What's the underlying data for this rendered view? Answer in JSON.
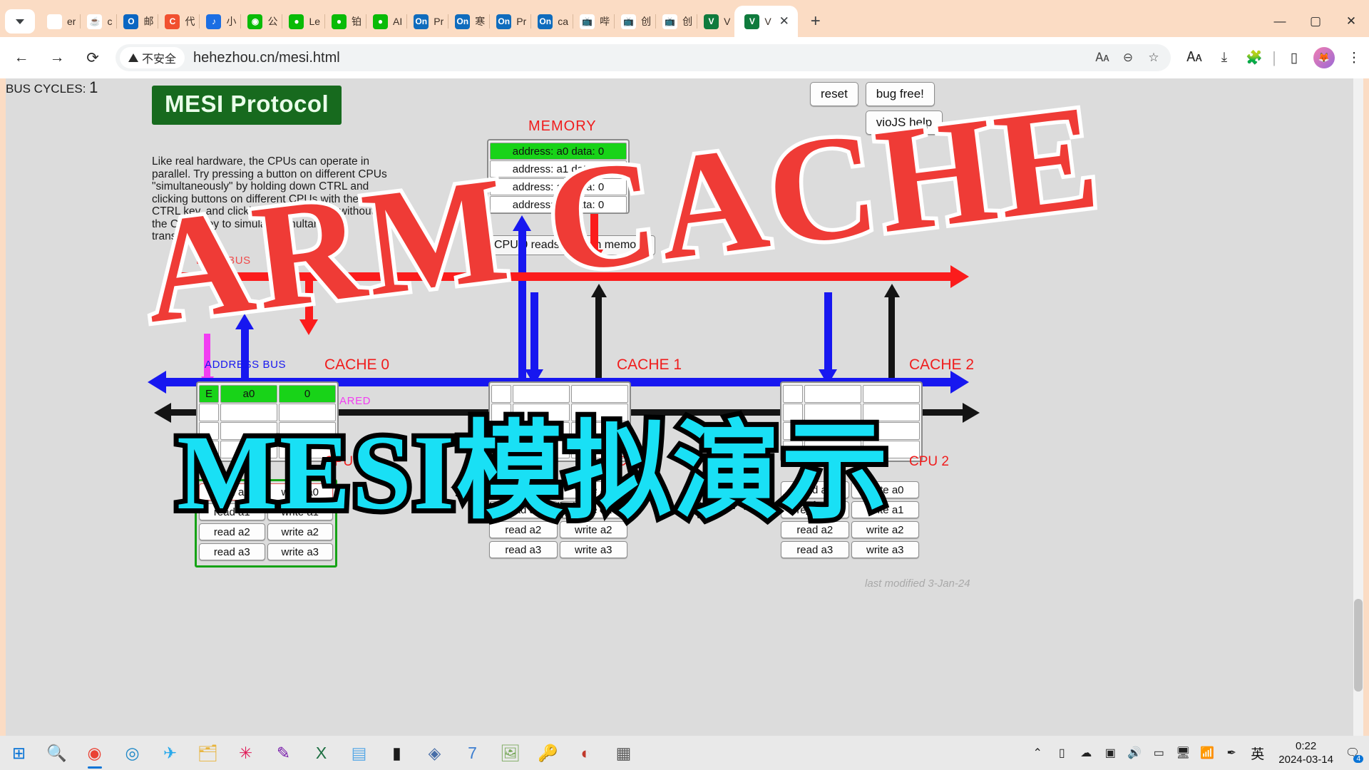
{
  "browser": {
    "tabs": [
      {
        "title": "er",
        "icon": "google-icon",
        "icon_glyph": "G",
        "style": "fav-g"
      },
      {
        "title": "c",
        "icon": "java-icon",
        "icon_glyph": "☕",
        "style": "fav-java"
      },
      {
        "title": "邮",
        "icon": "outlook-icon",
        "icon_glyph": "O",
        "style": "fav-out"
      },
      {
        "title": "代",
        "icon": "c-icon",
        "icon_glyph": "C",
        "style": "fav-c"
      },
      {
        "title": "小",
        "icon": "blue-circle-icon",
        "icon_glyph": "♪",
        "style": "fav-blue"
      },
      {
        "title": "公",
        "icon": "green-swirl-icon",
        "icon_glyph": "◉",
        "style": "fav-green2"
      },
      {
        "title": "Le",
        "icon": "wechat-icon",
        "icon_glyph": "●",
        "style": "fav-wx"
      },
      {
        "title": "铂",
        "icon": "wechat-icon",
        "icon_glyph": "●",
        "style": "fav-wx"
      },
      {
        "title": "AI",
        "icon": "wechat-icon",
        "icon_glyph": "●",
        "style": "fav-wx"
      },
      {
        "title": "Pr",
        "icon": "onenote-icon",
        "icon_glyph": "On",
        "style": "fav-on"
      },
      {
        "title": "寒",
        "icon": "onenote-icon",
        "icon_glyph": "On",
        "style": "fav-on"
      },
      {
        "title": "Pr",
        "icon": "onenote-icon",
        "icon_glyph": "On",
        "style": "fav-on"
      },
      {
        "title": "ca",
        "icon": "onenote-icon",
        "icon_glyph": "On",
        "style": "fav-on"
      },
      {
        "title": "哔",
        "icon": "bilibili-icon",
        "icon_glyph": "📺",
        "style": "fav-bili"
      },
      {
        "title": "创",
        "icon": "bilibili-icon",
        "icon_glyph": "📺",
        "style": "fav-bili"
      },
      {
        "title": "创",
        "icon": "bilibili-icon",
        "icon_glyph": "📺",
        "style": "fav-bili"
      },
      {
        "title": "V",
        "icon": "v-icon",
        "icon_glyph": "V",
        "style": "fav-v"
      }
    ],
    "active_tab": {
      "title": "V",
      "close_label": "✕"
    },
    "new_tab_label": "+",
    "window_controls": {
      "minimize": "—",
      "maximize": "▢",
      "close": "✕"
    },
    "toolbar": {
      "back": "←",
      "forward": "→",
      "reload": "⟳",
      "security_label": "不安全",
      "url": "hehezhou.cn/mesi.html",
      "translate_icon": "translate-icon",
      "zoom_icon": "zoom-out-icon",
      "bookmark_icon": "star-icon",
      "extensions_icon": "puzzle-icon",
      "downloads_icon": "download-icon",
      "sidepanel_icon": "side-panel-icon",
      "menu_icon": "three-dot-menu-icon",
      "profile_icon": "profile-avatar"
    }
  },
  "page": {
    "title": "MESI Protocol",
    "intro": "Like real hardware, the CPUs can operate in parallel. Try pressing a button on different CPUs \"simultaneously\" by holding down CTRL and clicking buttons on different CPUs with the CTRL key, and clicking the last button without the CTRL key to simulate simultaneous transactions.",
    "last_modified": "last modified  3-Jan-24",
    "status_message": "CPU 0 reads a0 from memory",
    "bus_cycles_label": "BUS CYCLES:",
    "bus_cycles_value": "1",
    "memory": {
      "label": "MEMORY",
      "rows": [
        {
          "text": "address: a0 data: 0",
          "highlight": true
        },
        {
          "text": "address: a1 data: 0",
          "highlight": false
        },
        {
          "text": "address: a2 data: 0",
          "highlight": false
        },
        {
          "text": "address: a3 data: 0",
          "highlight": false
        }
      ]
    },
    "buses": [
      {
        "name": "DATA BUS",
        "label": "DATA BUS",
        "color": "#fb1c1c"
      },
      {
        "name": "ADDRESS BUS",
        "label": "ADDRESS BUS",
        "color": "#1717f0"
      },
      {
        "name": "SHARED",
        "label": "SHARED",
        "color": "#f23df2"
      }
    ],
    "top_buttons": [
      {
        "label": "reset"
      },
      {
        "label": "bug free!"
      },
      {
        "label": "vioJS help"
      }
    ],
    "caches": [
      {
        "label": "CACHE 0",
        "cpu_label": "CPU 0",
        "selected": true,
        "rows": [
          {
            "tag": "E",
            "addr": "a0",
            "data": "0",
            "highlight": true
          },
          {
            "tag": "",
            "addr": "",
            "data": "",
            "highlight": false
          },
          {
            "tag": "",
            "addr": "",
            "data": "",
            "highlight": false
          },
          {
            "tag": "",
            "addr": "",
            "data": "",
            "highlight": false
          }
        ],
        "buttons": [
          [
            "read a0",
            "write a0"
          ],
          [
            "read a1",
            "write a1"
          ],
          [
            "read a2",
            "write a2"
          ],
          [
            "read a3",
            "write a3"
          ]
        ]
      },
      {
        "label": "CACHE 1",
        "cpu_label": "CPU 1",
        "selected": false,
        "rows": [
          {
            "tag": "",
            "addr": "",
            "data": "",
            "highlight": false
          },
          {
            "tag": "",
            "addr": "",
            "data": "",
            "highlight": false
          },
          {
            "tag": "",
            "addr": "",
            "data": "",
            "highlight": false
          },
          {
            "tag": "",
            "addr": "",
            "data": "",
            "highlight": false
          }
        ],
        "buttons": [
          [
            "read a0",
            "write a0"
          ],
          [
            "read a1",
            "write a1"
          ],
          [
            "read a2",
            "write a2"
          ],
          [
            "read a3",
            "write a3"
          ]
        ]
      },
      {
        "label": "CACHE 2",
        "cpu_label": "CPU 2",
        "selected": false,
        "rows": [
          {
            "tag": "",
            "addr": "",
            "data": "",
            "highlight": false
          },
          {
            "tag": "",
            "addr": "",
            "data": "",
            "highlight": false
          },
          {
            "tag": "",
            "addr": "",
            "data": "",
            "highlight": false
          },
          {
            "tag": "",
            "addr": "",
            "data": "",
            "highlight": false
          }
        ],
        "buttons": [
          [
            "read a0",
            "write a0"
          ],
          [
            "read a1",
            "write a1"
          ],
          [
            "read a2",
            "write a2"
          ],
          [
            "read a3",
            "write a3"
          ]
        ]
      }
    ]
  },
  "watermarks": {
    "top": "ARM CACHE",
    "bottom": "MESI模拟演示"
  },
  "taskbar": {
    "items": [
      {
        "name": "start-button",
        "glyph": "⊞",
        "color": "#0a74d6",
        "active": false
      },
      {
        "name": "search-button",
        "glyph": "🔍",
        "color": "#444",
        "active": false
      },
      {
        "name": "chrome-app",
        "glyph": "◉",
        "color": "#ea4335",
        "active": true
      },
      {
        "name": "edge-app",
        "glyph": "◎",
        "color": "#1e88c7",
        "active": false
      },
      {
        "name": "telegram-app",
        "glyph": "✈",
        "color": "#29a9eb",
        "active": false
      },
      {
        "name": "explorer-app",
        "glyph": "🗂",
        "color": "#e8b339",
        "active": false
      },
      {
        "name": "slack-app",
        "glyph": "✳",
        "color": "#e01e5a",
        "active": false
      },
      {
        "name": "onenote-app",
        "glyph": "✎",
        "color": "#7719aa",
        "active": false
      },
      {
        "name": "excel-app",
        "glyph": "X",
        "color": "#1d6f42",
        "active": false
      },
      {
        "name": "scanner-app",
        "glyph": "▤",
        "color": "#5aa9e6",
        "active": false
      },
      {
        "name": "terminal-app",
        "glyph": "▮",
        "color": "#1b1b1b",
        "active": false
      },
      {
        "name": "virtualbox-app",
        "glyph": "◈",
        "color": "#486ea8",
        "active": false
      },
      {
        "name": "notes-app",
        "glyph": "7",
        "color": "#3c7ed0",
        "active": false
      },
      {
        "name": "picture-app",
        "glyph": "🖼",
        "color": "#7aa95c",
        "active": false
      },
      {
        "name": "keepass-app",
        "glyph": "🔑",
        "color": "#3a3a3a",
        "active": false
      },
      {
        "name": "krita-app",
        "glyph": "◐",
        "color": "#c0392b",
        "active": false
      },
      {
        "name": "calculator-app",
        "glyph": "▦",
        "color": "#5a5a5a",
        "active": false
      }
    ],
    "tray": [
      {
        "name": "show-hidden-icons",
        "glyph": "⌃"
      },
      {
        "name": "mobile-icon",
        "glyph": "▯"
      },
      {
        "name": "cloud-icon",
        "glyph": "☁"
      },
      {
        "name": "app-tray-icon",
        "glyph": "▣"
      },
      {
        "name": "volume-icon",
        "glyph": "🔊"
      },
      {
        "name": "battery-icon",
        "glyph": "▭"
      },
      {
        "name": "monitor-icon",
        "glyph": "🖥"
      },
      {
        "name": "network-icon",
        "glyph": "📶"
      },
      {
        "name": "pen-icon",
        "glyph": "✒"
      }
    ],
    "ime": "英",
    "clock_time": "0:22",
    "clock_date": "2024-03-14",
    "notification_count": "4"
  }
}
